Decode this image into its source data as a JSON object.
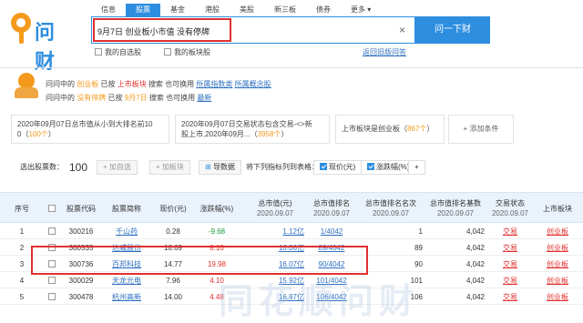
{
  "logo": {
    "text": "问财"
  },
  "tabs": [
    "信息",
    "股票",
    "基金",
    "港股",
    "美股",
    "新三板",
    "债券",
    "更多"
  ],
  "search": {
    "value": "9月7日 创业板小市值 没有停牌",
    "button": "问一下财",
    "clear": "×"
  },
  "options": {
    "my_watchlist": "我的自选股",
    "my_sector": "我的板块股",
    "feedback": "返回旧版问答"
  },
  "suggest": {
    "line1": {
      "prefix": "问问中的",
      "term1": "创业板",
      "mid1": "已按",
      "term2": "上市板块",
      "mid2": "搜索",
      "mid3": "也可换用",
      "link1": "所属指数类",
      "link2": "所属概念股"
    },
    "line2": {
      "prefix": "问问中的",
      "term1": "没有停牌",
      "mid1": "已按",
      "term2": "9月7日",
      "mid2": "搜索",
      "mid3": "也可换用",
      "link1": "最新"
    }
  },
  "conditions": [
    {
      "text": "2020年09月07日总市值从小到大排名前10",
      "sub": "0（",
      "count": "100个",
      "end": "）"
    },
    {
      "text": "2020年09月07日交易状态包含交易-<>新",
      "sub": "股上市,2020年09月...（",
      "count": "3958个",
      "end": "）"
    },
    {
      "text": "上市板块是创业板（",
      "count": "867个",
      "end": "）"
    }
  ],
  "add_condition": "+ 添加条件",
  "toolbar": {
    "selected_label": "选出股票数：",
    "selected_count": "100",
    "add_watch": "+ 加自选",
    "add_sector": "+ 加板块",
    "export": "导数据",
    "show_label": "将下列指标列到表格：",
    "ind1": "现价(元)",
    "ind2": "涨跌幅(%)",
    "plus": "+"
  },
  "table": {
    "headers": {
      "no": "序号",
      "code": "股票代码",
      "name": "股票简称",
      "price": "现价(元)",
      "change": "涨跌幅(%)",
      "mcap": "总市值(元)",
      "mcap_date": "2020.09.07",
      "rank": "总市值排名",
      "rank_date": "2020.09.07",
      "rank_count": "总市值排名名次",
      "rank_count_date": "2020.09.07",
      "rank_total": "总市值排名基数",
      "rank_total_date": "2020.09.07",
      "status": "交易状态",
      "status_date": "2020.09.07",
      "board": "上市板块"
    },
    "rows": [
      {
        "no": "1",
        "code": "300216",
        "name": "千山药",
        "price": "0.28",
        "change": "-9.68",
        "mcap": "1.12亿",
        "rank": "1/4042",
        "rank_count": "1",
        "rank_total": "4,042",
        "status": "交易",
        "board": "创业板"
      },
      {
        "no": "2",
        "code": "300535",
        "name": "达威股份",
        "price": "16.69",
        "change": "8.10",
        "mcap": "16.06亿",
        "rank": "89/4042",
        "rank_count": "89",
        "rank_total": "4,042",
        "status": "交易",
        "board": "创业板"
      },
      {
        "no": "3",
        "code": "300736",
        "name": "百邦科技",
        "price": "14.77",
        "change": "19.98",
        "mcap": "16.07亿",
        "rank": "90/4042",
        "rank_count": "90",
        "rank_total": "4,042",
        "status": "交易",
        "board": "创业板"
      },
      {
        "no": "4",
        "code": "300029",
        "name": "天龙光电",
        "price": "7.96",
        "change": "4.10",
        "mcap": "15.92亿",
        "rank": "101/4042",
        "rank_count": "101",
        "rank_total": "4,042",
        "status": "交易",
        "board": "创业板"
      },
      {
        "no": "5",
        "code": "300478",
        "name": "杭州高新",
        "price": "14.00",
        "change": "4.48",
        "mcap": "16.97亿",
        "rank": "106/4042",
        "rank_count": "106",
        "rank_total": "4,042",
        "status": "交易",
        "board": "创业板"
      }
    ]
  },
  "watermark": "同花顺问财"
}
